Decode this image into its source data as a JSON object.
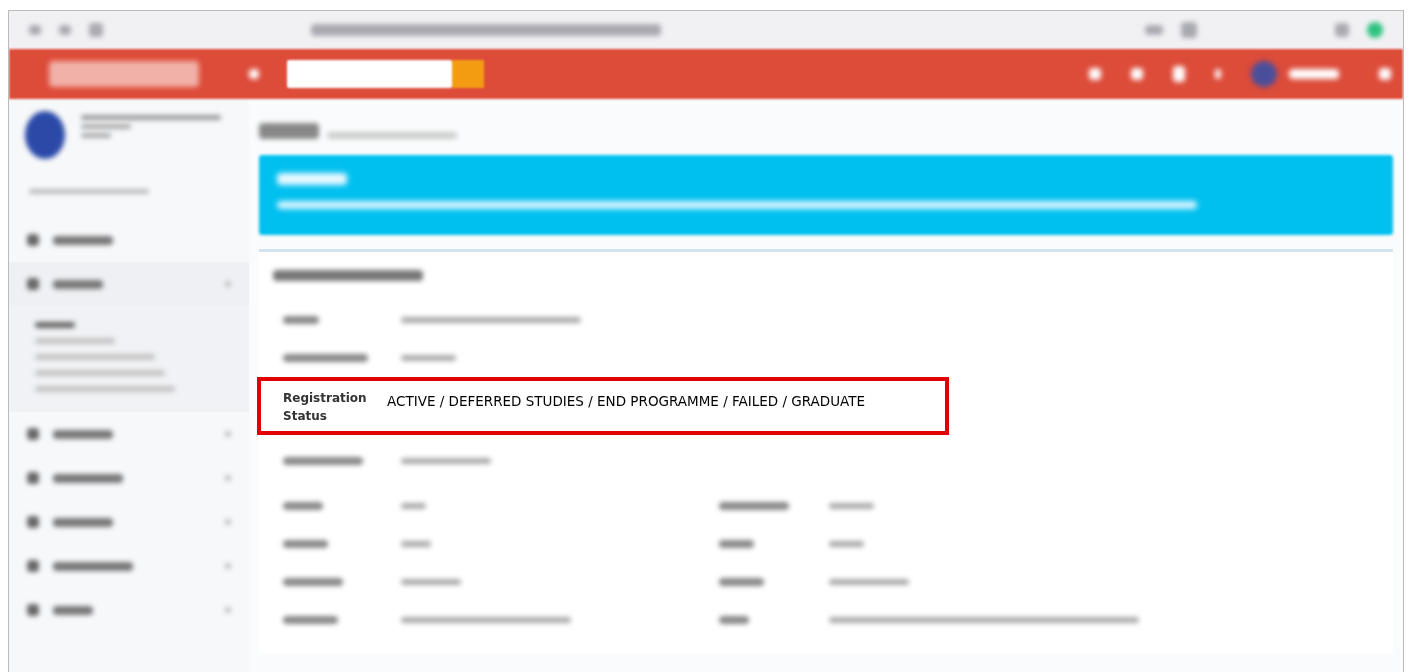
{
  "highlighted_field": {
    "label": "Registration Status",
    "value": "ACTIVE / DEFERRED STUDIES / END PROGRAMME / FAILED / GRADUATE"
  }
}
